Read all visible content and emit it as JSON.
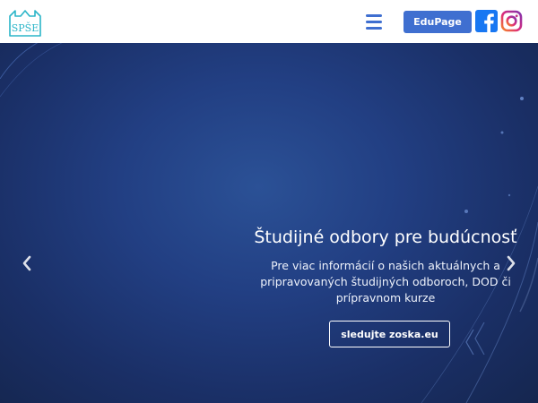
{
  "header": {
    "logo_text": "SPŠE",
    "menu_icon": "hamburger-menu-icon",
    "edupage_label": "EduPage",
    "facebook_icon": "facebook-icon",
    "instagram_icon": "instagram-icon"
  },
  "hero": {
    "title": "Študijné odbory pre budúcnosť",
    "description": "Pre viac informácií o našich aktuálnych a pripravovaných študijných odboroch, DOD či prípravnom kurze",
    "cta_label": "sledujte zoska.eu",
    "prev_icon": "chevron-left-icon",
    "next_icon": "chevron-right-icon"
  },
  "colors": {
    "accent": "#3f6fd0",
    "logo": "#2bb5c8",
    "facebook": "#1877f2",
    "instagram": "#c13584",
    "hero_dark": "#15264f",
    "hero_light": "#2b5196"
  }
}
